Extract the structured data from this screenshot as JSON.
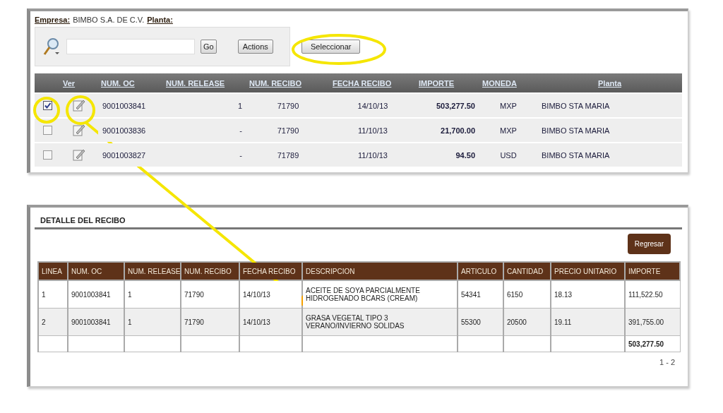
{
  "header": {
    "company_label": "Empresa:",
    "company": "BIMBO S.A. DE C.V.",
    "plant_label": "Planta:"
  },
  "search": {
    "go_button": "Go",
    "actions_button": "Actions"
  },
  "select_button": "Seleccionar",
  "orders": {
    "view_column": "Ver",
    "columns": [
      "NUM. OC",
      "NUM. RELEASE",
      "NUM. RECIBO",
      "FECHA RECIBO",
      "IMPORTE",
      "MONEDA",
      "Planta"
    ],
    "rows": [
      {
        "checked": true,
        "cells": [
          "9001003841",
          "1",
          "71790",
          "14/10/13",
          "503,277.50",
          "MXP",
          "BIMBO STA MARIA"
        ]
      },
      {
        "checked": false,
        "cells": [
          "9001003836",
          "-",
          "71790",
          "11/10/13",
          "21,700.00",
          "MXP",
          "BIMBO STA MARIA"
        ]
      },
      {
        "checked": false,
        "cells": [
          "9001003827",
          "-",
          "71789",
          "11/10/13",
          "94.50",
          "USD",
          "BIMBO STA MARIA"
        ]
      }
    ]
  },
  "detail": {
    "title": "DETALLE DEL RECIBO",
    "back_button": "Regresar",
    "columns": [
      "LINEA",
      "NUM. OC",
      "NUM. RELEASE",
      "NUM. RECIBO",
      "FECHA RECIBO",
      "DESCRIPCION",
      "ARTICULO",
      "CANTIDAD",
      "PRECIO UNITARIO",
      "IMPORTE"
    ],
    "rows": [
      [
        "1",
        "9001003841",
        "1",
        "71790",
        "14/10/13",
        "ACEITE DE SOYA PARCIALMENTE HIDROGENADO BCARS (CREAM)",
        "54341",
        "6150",
        "18.13",
        "111,522.50"
      ],
      [
        "2",
        "9001003841",
        "1",
        "71790",
        "14/10/13",
        "GRASA VEGETAL TIPO 3 VERANO/INVIERNO SOLIDAS",
        "55300",
        "20500",
        "19.11",
        "391,755.00"
      ]
    ],
    "total": "503,277.50",
    "pagination": "1 - 2"
  }
}
